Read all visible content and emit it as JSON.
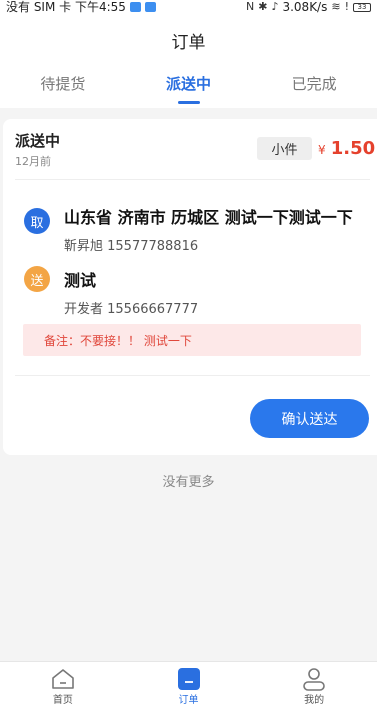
{
  "status_bar": {
    "left_text": "没有 SIM 卡 下午4:55",
    "speed": "3.08K/s",
    "battery": "33"
  },
  "header": {
    "title": "订单"
  },
  "tabs": [
    {
      "label": "待提货",
      "active": false
    },
    {
      "label": "派送中",
      "active": true
    },
    {
      "label": "已完成",
      "active": false
    }
  ],
  "order": {
    "status": "派送中",
    "time": "12月前",
    "size": "小件",
    "currency": "¥",
    "price": "1.50",
    "pickup": {
      "pin": "取",
      "address": "山东省 济南市 历城区 测试一下测试一下",
      "contact": "靳昇旭 15577788816"
    },
    "delivery": {
      "pin": "送",
      "name": "测试",
      "contact": "开发者 15566667777"
    },
    "remark": "备注：不要接！！ 测试一下",
    "confirm_label": "确认送达"
  },
  "list_end": "没有更多",
  "bottom_nav": [
    {
      "label": "首页",
      "icon": "home-icon",
      "active": false
    },
    {
      "label": "订单",
      "icon": "order-icon",
      "active": true
    },
    {
      "label": "我的",
      "icon": "profile-icon",
      "active": false
    }
  ],
  "colors": {
    "accent": "#2a6fe0",
    "price": "#e5412d",
    "pickup_pin": "#2a6fe0",
    "delivery_pin": "#f3a545",
    "remark_bg": "#fde8e8"
  }
}
